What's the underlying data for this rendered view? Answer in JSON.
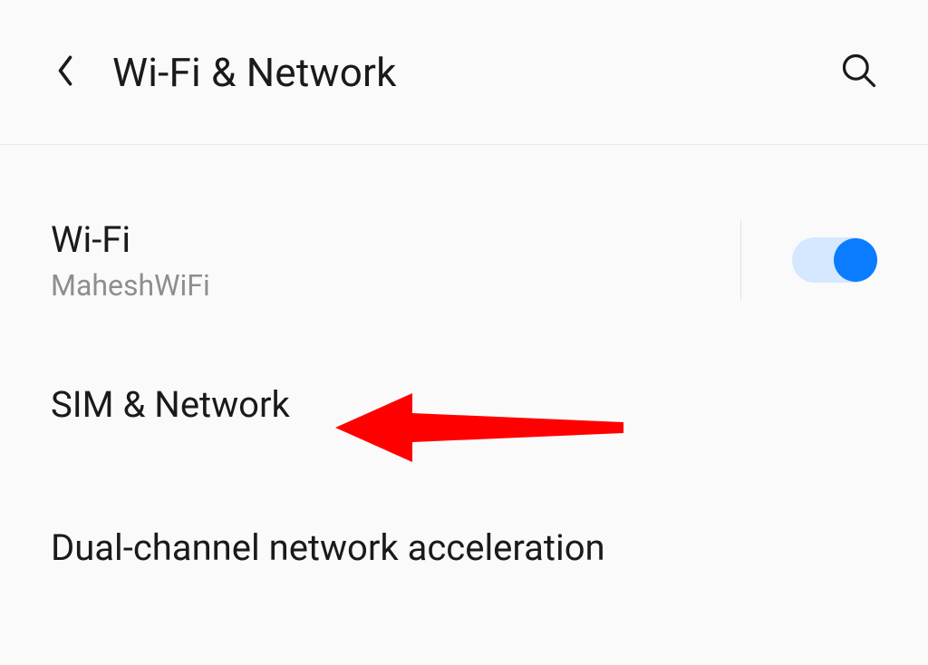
{
  "header": {
    "title": "Wi-Fi & Network"
  },
  "rows": {
    "wifi": {
      "title": "Wi-Fi",
      "subtitle": "MaheshWiFi",
      "toggle_on": true
    },
    "sim": {
      "title": "SIM & Network"
    },
    "dual": {
      "title": "Dual-channel network acceleration"
    }
  },
  "annotation": {
    "arrow_color": "#ff0000"
  }
}
